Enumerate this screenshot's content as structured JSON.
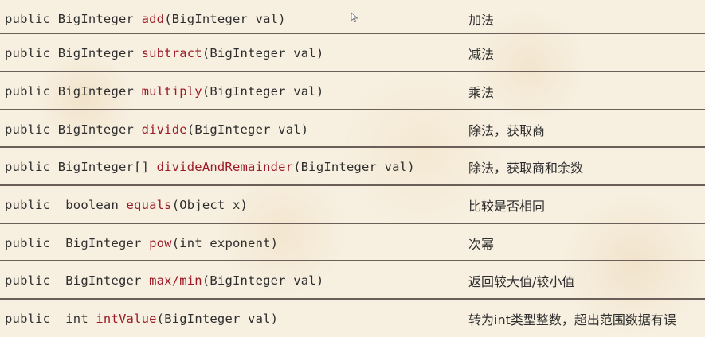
{
  "rows": [
    {
      "pre": "public BigInteger ",
      "method": "add",
      "post": "(BigInteger val)",
      "desc": "加法"
    },
    {
      "pre": "public BigInteger ",
      "method": "subtract",
      "post": "(BigInteger val)",
      "desc": "减法"
    },
    {
      "pre": "public BigInteger ",
      "method": "multiply",
      "post": "(BigInteger val)",
      "desc": "乘法"
    },
    {
      "pre": "public BigInteger ",
      "method": "divide",
      "post": "(BigInteger val)",
      "desc": "除法，获取商"
    },
    {
      "pre": "public BigInteger[] ",
      "method": "divideAndRemainder",
      "post": "(BigInteger val)",
      "desc": "除法，获取商和余数"
    },
    {
      "pre": "public  boolean ",
      "method": "equals",
      "post": "(Object x)",
      "desc": "比较是否相同"
    },
    {
      "pre": "public  BigInteger ",
      "method": "pow",
      "post": "(int exponent)",
      "desc": "次幂"
    },
    {
      "pre": "public  BigInteger ",
      "method": "max/min",
      "post": "(BigInteger val)",
      "desc": "返回较大值/较小值"
    },
    {
      "pre": "public  int ",
      "method": "intValue",
      "post": "(BigInteger val)",
      "desc": "转为int类型整数，超出范围数据有误"
    }
  ],
  "colors": {
    "method": "#9c1a26",
    "text": "#2e2e2e",
    "divider": "#6b5f57",
    "background": "#f7efe0"
  },
  "icons": {
    "cursor": "mouse-pointer-icon"
  }
}
